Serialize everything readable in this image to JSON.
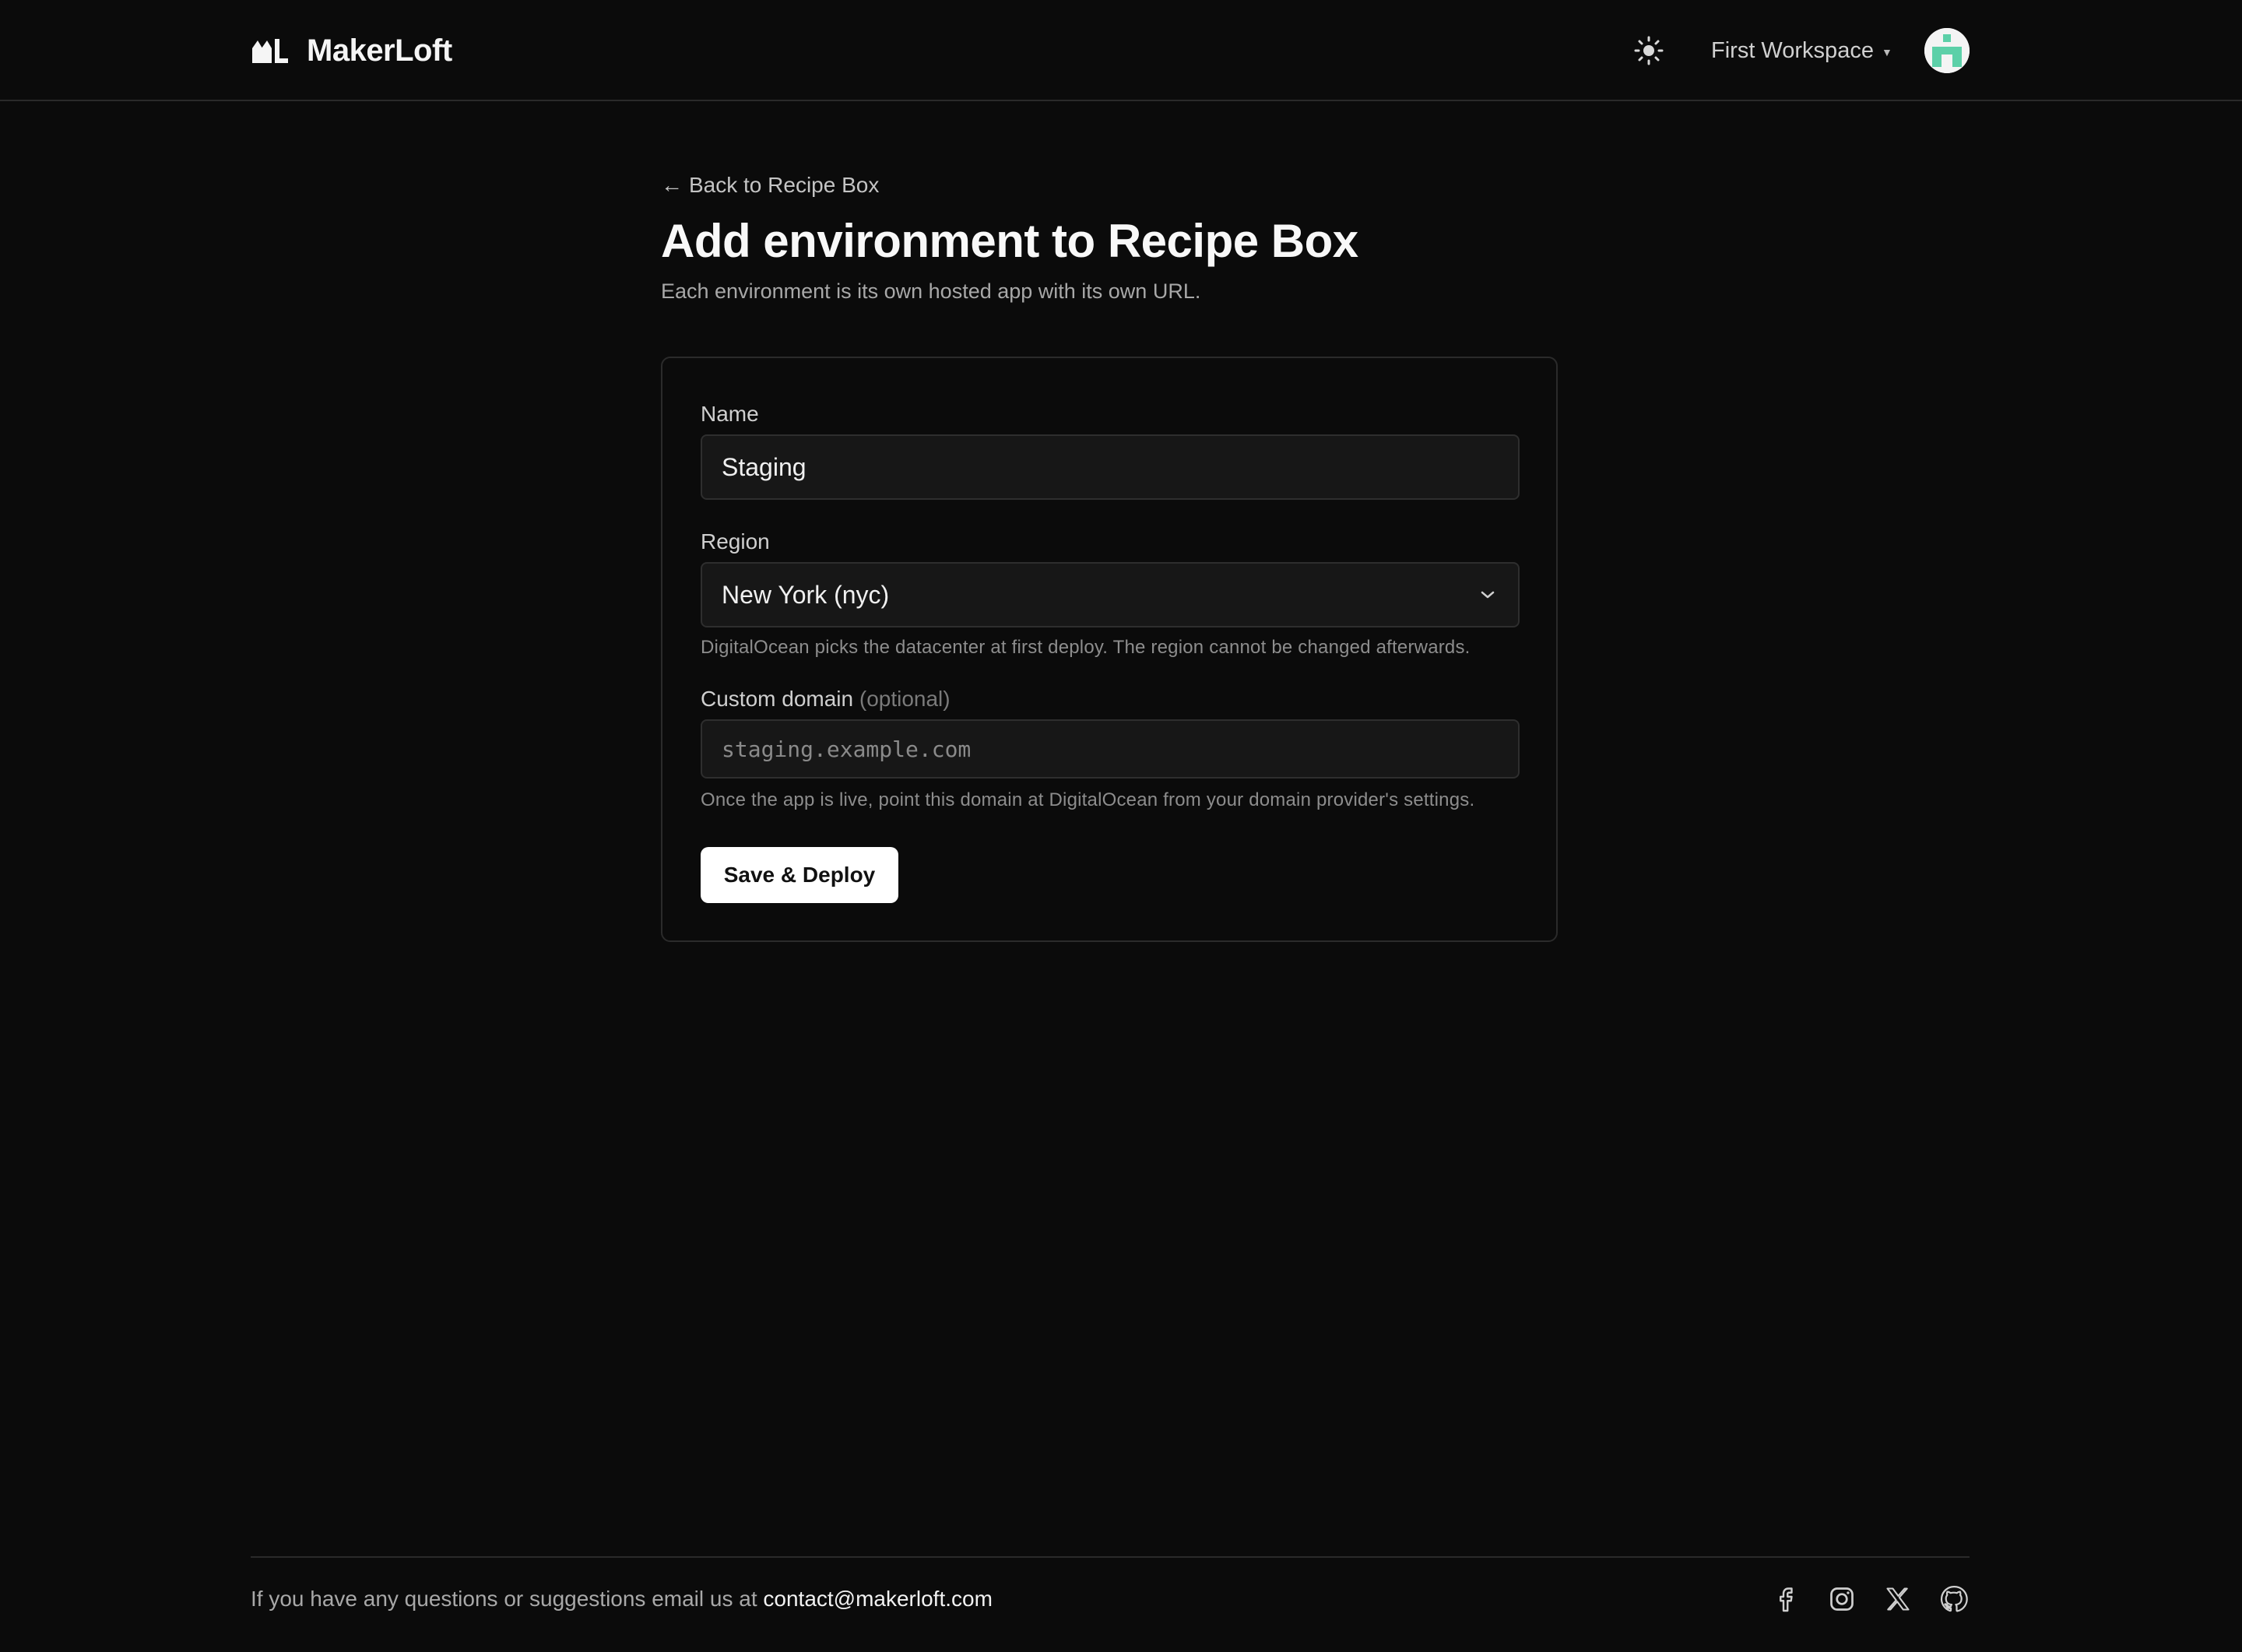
{
  "header": {
    "brand_name": "MakerLoft",
    "workspace_name": "First Workspace",
    "theme_icon": "sun-icon",
    "avatar_colors": {
      "primary": "#5cd0a8",
      "background": "#f4f4f4"
    }
  },
  "main": {
    "back_link": "Back to Recipe Box",
    "title": "Add environment to Recipe Box",
    "subtitle": "Each environment is its own hosted app with its own URL."
  },
  "form": {
    "name_label": "Name",
    "name_value": "Staging",
    "region_label": "Region",
    "region_value": "New York (nyc)",
    "region_hint": "DigitalOcean picks the datacenter at first deploy. The region cannot be changed afterwards.",
    "domain_label": "Custom domain",
    "domain_optional": "(optional)",
    "domain_placeholder": "staging.example.com",
    "domain_value": "",
    "domain_hint": "Once the app is live, point this domain at DigitalOcean from your domain provider's settings.",
    "submit_label": "Save & Deploy"
  },
  "footer": {
    "text": "If you have any questions or suggestions email us at",
    "email": "contact@makerloft.com",
    "social_icons": [
      "facebook-icon",
      "instagram-icon",
      "x-icon",
      "github-icon"
    ]
  },
  "colors": {
    "background": "#0b0b0b",
    "primary_button_bg": "#ffffff",
    "input_bg": "#171717",
    "border": "#2b2b2b"
  }
}
